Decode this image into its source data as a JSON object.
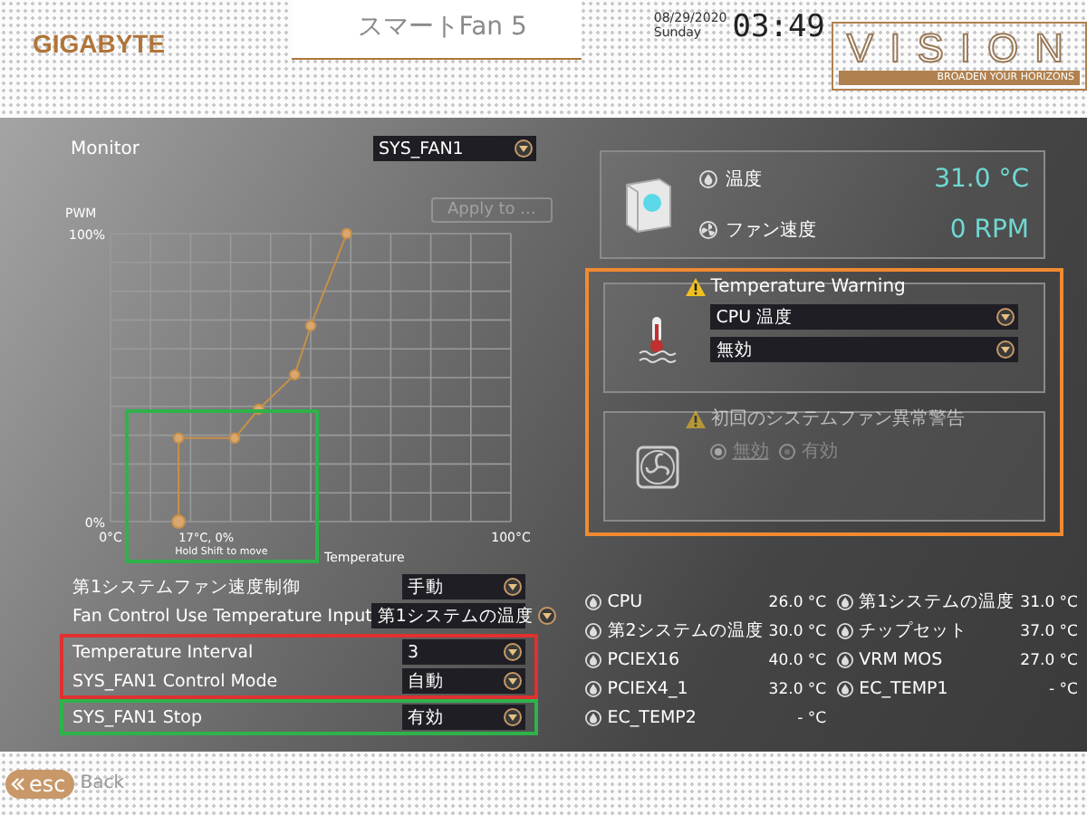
{
  "header": {
    "logo": "GIGABYTE",
    "title": "スマートFan 5",
    "date": "08/29/2020",
    "day": "Sunday",
    "time": "03:49",
    "brand": "VISION",
    "tagline": "BROADEN YOUR HORIZONS"
  },
  "monitor": {
    "label": "Monitor",
    "value": "SYS_FAN1"
  },
  "apply_button": {
    "label": "Apply to ...",
    "disabled": true
  },
  "fan_curve": {
    "frame": {
      "color": "#2eb34a"
    },
    "point_label": "17°C, 0%",
    "hint": "Hold Shift to move",
    "chart_data": {
      "type": "line",
      "xlabel": "Temperature",
      "ylabel": "PWM",
      "x": [
        17,
        17,
        31,
        37,
        46,
        50,
        59
      ],
      "series": [
        {
          "color": "#c8904a",
          "marker": "circle",
          "values": [
            0,
            29,
            29,
            39,
            51,
            68,
            100
          ]
        }
      ],
      "xlim": [
        0,
        100
      ],
      "ylim": [
        0,
        100
      ],
      "xticks": [
        {
          "value": 0,
          "label": "0°C"
        },
        {
          "value": 100,
          "label": "100°C"
        }
      ],
      "yticks": [
        {
          "value": 0,
          "label": "0%"
        },
        {
          "value": 100,
          "label": "100%"
        }
      ]
    }
  },
  "settings": [
    {
      "rows": [
        {
          "label": "第1システムファン速度制御",
          "value": "手動"
        },
        {
          "label": "Fan Control Use Temperature Input",
          "value": "第1システムの温度"
        }
      ]
    },
    {
      "frame": {
        "color": "#e03030"
      },
      "rows": [
        {
          "label": "Temperature Interval",
          "value": "3"
        },
        {
          "label": "SYS_FAN1 Control Mode",
          "value": "自動"
        }
      ]
    },
    {
      "frame": {
        "color": "#2eb34a"
      },
      "rows": [
        {
          "label": "SYS_FAN1 Stop",
          "value": "有効"
        }
      ]
    }
  ],
  "status": [
    {
      "kind": "temperature",
      "label": "温度",
      "value": "31.0 °C"
    },
    {
      "kind": "fan",
      "label": "ファン速度",
      "value": "0 RPM"
    }
  ],
  "warnings": {
    "frame": {
      "color": "#f08a30"
    },
    "temperature_warning": {
      "title": "Temperature Warning",
      "source": "CPU 温度",
      "threshold": "無効"
    },
    "fan_fail_warning": {
      "title": "初回のシステムファン異常警告",
      "disabled": true,
      "options": [
        {
          "label": "無効",
          "selected": true
        },
        {
          "label": "有効",
          "selected": false
        }
      ]
    }
  },
  "temperatures": [
    {
      "label": "CPU",
      "value": "26.0 °C"
    },
    {
      "label": "第1システムの温度",
      "value": "31.0 °C"
    },
    {
      "label": "第2システムの温度",
      "value": "30.0 °C"
    },
    {
      "label": "チップセット",
      "value": "37.0 °C"
    },
    {
      "label": "PCIEX16",
      "value": "40.0 °C"
    },
    {
      "label": "VRM MOS",
      "value": "27.0 °C"
    },
    {
      "label": "PCIEX4_1",
      "value": "32.0 °C"
    },
    {
      "label": "EC_TEMP1",
      "value": "- °C"
    },
    {
      "label": "EC_TEMP2",
      "value": "- °C"
    }
  ],
  "footer": {
    "key": "esc",
    "label": "Back"
  }
}
